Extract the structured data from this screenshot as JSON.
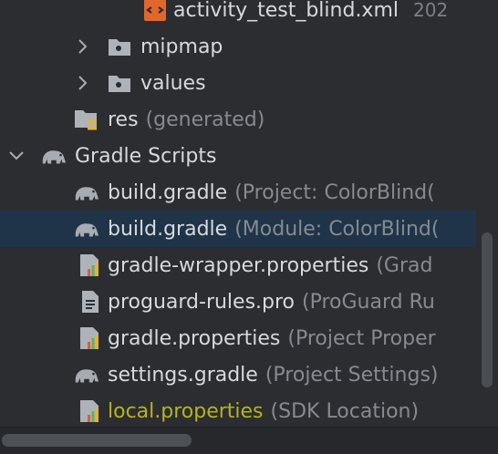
{
  "tree": {
    "rows": [
      {
        "name": "activity_test_blind.xml",
        "hint": "",
        "date": "202"
      },
      {
        "name": "mipmap",
        "hint": ""
      },
      {
        "name": "values",
        "hint": ""
      },
      {
        "name": "res",
        "hint": "(generated)"
      },
      {
        "name": "Gradle Scripts",
        "hint": ""
      },
      {
        "name": "build.gradle",
        "hint": "(Project: ColorBlind("
      },
      {
        "name": "build.gradle",
        "hint": "(Module: ColorBlind("
      },
      {
        "name": "gradle-wrapper.properties",
        "hint": "(Grad"
      },
      {
        "name": "proguard-rules.pro",
        "hint": "(ProGuard Ru"
      },
      {
        "name": "gradle.properties",
        "hint": "(Project Proper"
      },
      {
        "name": "settings.gradle",
        "hint": "(Project Settings)"
      },
      {
        "name": "local.properties",
        "hint": "(SDK Location)"
      }
    ],
    "selected_index": 6
  },
  "icons": {
    "xml": "xml-file-icon",
    "folder": "folder-icon",
    "generated_folder": "generated-folder-icon",
    "gradle": "gradle-elephant-icon",
    "properties": "properties-file-icon",
    "text_file": "text-file-icon",
    "chevron_right": "chevron-right-icon",
    "chevron_down": "chevron-down-icon"
  },
  "colors": {
    "background": "#2b2d30",
    "selection": "#1f3449",
    "text": "#d7d9dd",
    "hint_text": "#878a8f",
    "local_properties_text": "#b8b222",
    "xml_icon": "#e2672b"
  }
}
